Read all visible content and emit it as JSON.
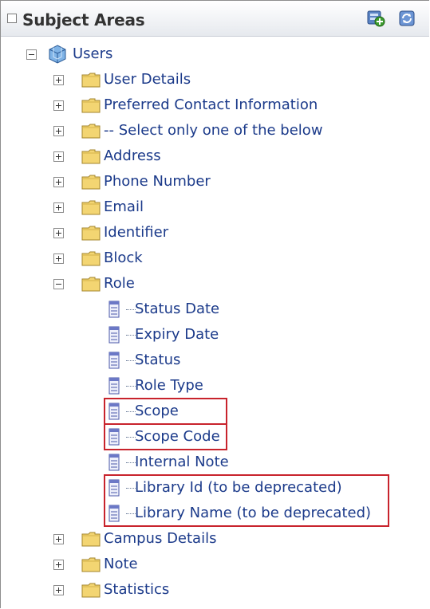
{
  "header": {
    "title": "Subject Areas",
    "add_icon": "add-subject-area-icon",
    "refresh_icon": "refresh-icon"
  },
  "tree": {
    "root": {
      "label": "Users",
      "expanded": true,
      "icon": "cube-icon"
    },
    "folders_before": [
      {
        "label": "User Details",
        "expanded": false
      },
      {
        "label": "Preferred Contact Information",
        "expanded": false
      },
      {
        "label": "-- Select only one of the below",
        "expanded": false
      },
      {
        "label": "Address",
        "expanded": false
      },
      {
        "label": "Phone Number",
        "expanded": false
      },
      {
        "label": "Email",
        "expanded": false
      },
      {
        "label": "Identifier",
        "expanded": false
      },
      {
        "label": "Block",
        "expanded": false
      }
    ],
    "role": {
      "label": "Role",
      "expanded": true,
      "columns": [
        {
          "label": "Status Date",
          "highlighted": false
        },
        {
          "label": "Expiry Date",
          "highlighted": false
        },
        {
          "label": "Status",
          "highlighted": false
        },
        {
          "label": "Role Type",
          "highlighted": false
        },
        {
          "label": "Scope",
          "highlighted": true
        },
        {
          "label": "Scope Code",
          "highlighted": true
        },
        {
          "label": "Internal Note",
          "highlighted": false
        },
        {
          "label": "Library Id (to be deprecated)",
          "highlighted": true
        },
        {
          "label": "Library Name (to be deprecated)",
          "highlighted": true
        }
      ]
    },
    "folders_after": [
      {
        "label": "Campus Details",
        "expanded": false
      },
      {
        "label": "Note",
        "expanded": false
      },
      {
        "label": "Statistics",
        "expanded": false
      }
    ]
  },
  "colors": {
    "label_text": "#1b3a8a",
    "highlight_border": "#c8232c",
    "folder_fill": "#f3d572"
  }
}
